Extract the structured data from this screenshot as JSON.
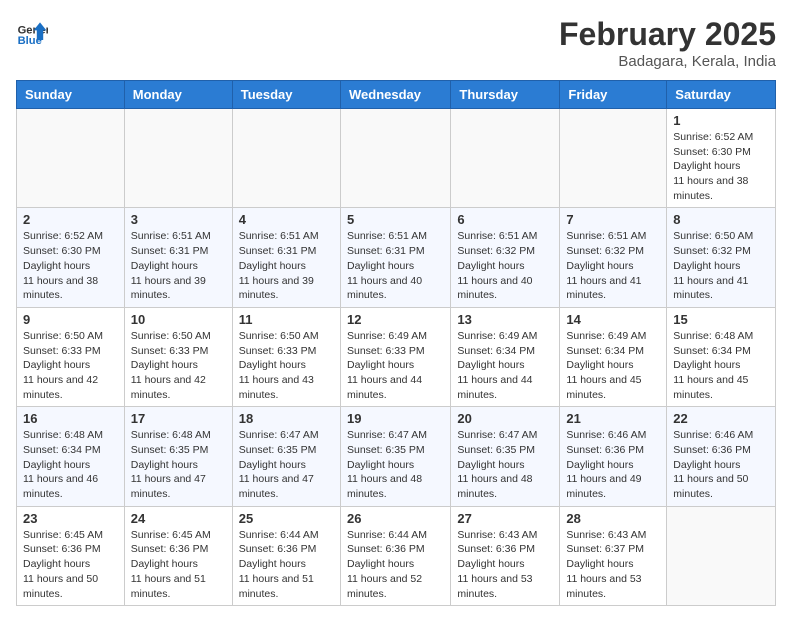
{
  "header": {
    "logo_general": "General",
    "logo_blue": "Blue",
    "month_year": "February 2025",
    "location": "Badagara, Kerala, India"
  },
  "weekdays": [
    "Sunday",
    "Monday",
    "Tuesday",
    "Wednesday",
    "Thursday",
    "Friday",
    "Saturday"
  ],
  "weeks": [
    [
      {
        "day": "",
        "empty": true
      },
      {
        "day": "",
        "empty": true
      },
      {
        "day": "",
        "empty": true
      },
      {
        "day": "",
        "empty": true
      },
      {
        "day": "",
        "empty": true
      },
      {
        "day": "",
        "empty": true
      },
      {
        "day": "1",
        "sunrise": "6:52 AM",
        "sunset": "6:30 PM",
        "daylight": "11 hours and 38 minutes."
      }
    ],
    [
      {
        "day": "2",
        "sunrise": "6:52 AM",
        "sunset": "6:30 PM",
        "daylight": "11 hours and 38 minutes."
      },
      {
        "day": "3",
        "sunrise": "6:51 AM",
        "sunset": "6:31 PM",
        "daylight": "11 hours and 39 minutes."
      },
      {
        "day": "4",
        "sunrise": "6:51 AM",
        "sunset": "6:31 PM",
        "daylight": "11 hours and 39 minutes."
      },
      {
        "day": "5",
        "sunrise": "6:51 AM",
        "sunset": "6:31 PM",
        "daylight": "11 hours and 40 minutes."
      },
      {
        "day": "6",
        "sunrise": "6:51 AM",
        "sunset": "6:32 PM",
        "daylight": "11 hours and 40 minutes."
      },
      {
        "day": "7",
        "sunrise": "6:51 AM",
        "sunset": "6:32 PM",
        "daylight": "11 hours and 41 minutes."
      },
      {
        "day": "8",
        "sunrise": "6:50 AM",
        "sunset": "6:32 PM",
        "daylight": "11 hours and 41 minutes."
      }
    ],
    [
      {
        "day": "9",
        "sunrise": "6:50 AM",
        "sunset": "6:33 PM",
        "daylight": "11 hours and 42 minutes."
      },
      {
        "day": "10",
        "sunrise": "6:50 AM",
        "sunset": "6:33 PM",
        "daylight": "11 hours and 42 minutes."
      },
      {
        "day": "11",
        "sunrise": "6:50 AM",
        "sunset": "6:33 PM",
        "daylight": "11 hours and 43 minutes."
      },
      {
        "day": "12",
        "sunrise": "6:49 AM",
        "sunset": "6:33 PM",
        "daylight": "11 hours and 44 minutes."
      },
      {
        "day": "13",
        "sunrise": "6:49 AM",
        "sunset": "6:34 PM",
        "daylight": "11 hours and 44 minutes."
      },
      {
        "day": "14",
        "sunrise": "6:49 AM",
        "sunset": "6:34 PM",
        "daylight": "11 hours and 45 minutes."
      },
      {
        "day": "15",
        "sunrise": "6:48 AM",
        "sunset": "6:34 PM",
        "daylight": "11 hours and 45 minutes."
      }
    ],
    [
      {
        "day": "16",
        "sunrise": "6:48 AM",
        "sunset": "6:34 PM",
        "daylight": "11 hours and 46 minutes."
      },
      {
        "day": "17",
        "sunrise": "6:48 AM",
        "sunset": "6:35 PM",
        "daylight": "11 hours and 47 minutes."
      },
      {
        "day": "18",
        "sunrise": "6:47 AM",
        "sunset": "6:35 PM",
        "daylight": "11 hours and 47 minutes."
      },
      {
        "day": "19",
        "sunrise": "6:47 AM",
        "sunset": "6:35 PM",
        "daylight": "11 hours and 48 minutes."
      },
      {
        "day": "20",
        "sunrise": "6:47 AM",
        "sunset": "6:35 PM",
        "daylight": "11 hours and 48 minutes."
      },
      {
        "day": "21",
        "sunrise": "6:46 AM",
        "sunset": "6:36 PM",
        "daylight": "11 hours and 49 minutes."
      },
      {
        "day": "22",
        "sunrise": "6:46 AM",
        "sunset": "6:36 PM",
        "daylight": "11 hours and 50 minutes."
      }
    ],
    [
      {
        "day": "23",
        "sunrise": "6:45 AM",
        "sunset": "6:36 PM",
        "daylight": "11 hours and 50 minutes."
      },
      {
        "day": "24",
        "sunrise": "6:45 AM",
        "sunset": "6:36 PM",
        "daylight": "11 hours and 51 minutes."
      },
      {
        "day": "25",
        "sunrise": "6:44 AM",
        "sunset": "6:36 PM",
        "daylight": "11 hours and 51 minutes."
      },
      {
        "day": "26",
        "sunrise": "6:44 AM",
        "sunset": "6:36 PM",
        "daylight": "11 hours and 52 minutes."
      },
      {
        "day": "27",
        "sunrise": "6:43 AM",
        "sunset": "6:36 PM",
        "daylight": "11 hours and 53 minutes."
      },
      {
        "day": "28",
        "sunrise": "6:43 AM",
        "sunset": "6:37 PM",
        "daylight": "11 hours and 53 minutes."
      },
      {
        "day": "",
        "empty": true
      }
    ]
  ]
}
